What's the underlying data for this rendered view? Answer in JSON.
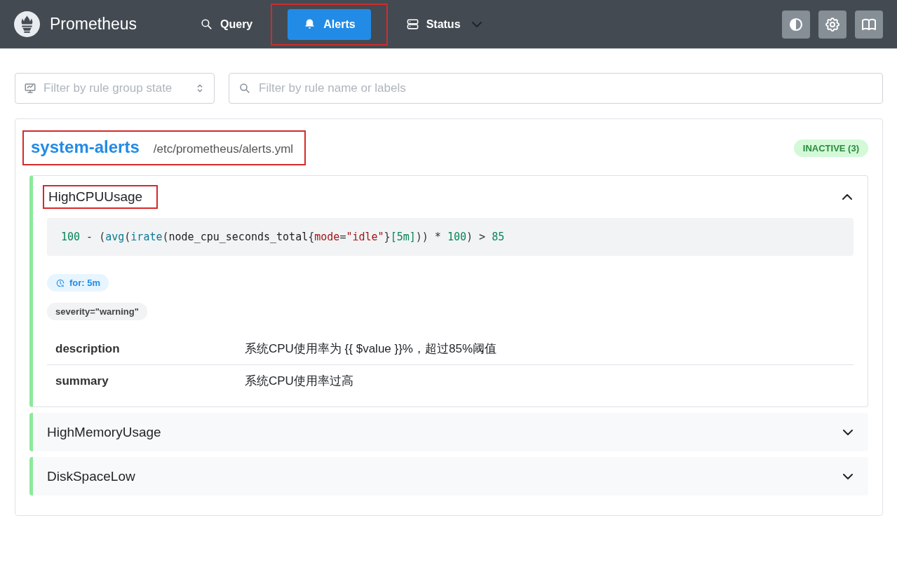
{
  "header": {
    "brand": "Prometheus",
    "nav": [
      {
        "label": "Query",
        "selected": false,
        "highlighted": false,
        "dropdown": false
      },
      {
        "label": "Alerts",
        "selected": true,
        "highlighted": true,
        "dropdown": false
      },
      {
        "label": "Status",
        "selected": false,
        "highlighted": false,
        "dropdown": true
      }
    ]
  },
  "filters": {
    "state_select": {
      "placeholder": "Filter by rule group state"
    },
    "search": {
      "placeholder": "Filter by rule name or labels"
    }
  },
  "groups": [
    {
      "name": "system-alerts",
      "file": "/etc/prometheus/alerts.yml",
      "highlighted": true,
      "badge": "INACTIVE (3)",
      "rules": [
        {
          "name": "HighCPUUsage",
          "expanded": true,
          "highlighted": true,
          "expression": [
            {
              "kind": "number",
              "text": "100"
            },
            {
              "kind": "op",
              "text": " - "
            },
            {
              "kind": "paren",
              "text": "("
            },
            {
              "kind": "func",
              "text": "avg"
            },
            {
              "kind": "paren",
              "text": "("
            },
            {
              "kind": "func",
              "text": "irate"
            },
            {
              "kind": "paren",
              "text": "("
            },
            {
              "kind": "metric",
              "text": "node_cpu_seconds_total"
            },
            {
              "kind": "paren",
              "text": "{"
            },
            {
              "kind": "label",
              "text": "mode"
            },
            {
              "kind": "op",
              "text": "="
            },
            {
              "kind": "string",
              "text": "\"idle\""
            },
            {
              "kind": "paren",
              "text": "}"
            },
            {
              "kind": "duration",
              "text": "[5m]"
            },
            {
              "kind": "paren",
              "text": "))"
            },
            {
              "kind": "op",
              "text": " * "
            },
            {
              "kind": "number",
              "text": "100"
            },
            {
              "kind": "paren",
              "text": ")"
            },
            {
              "kind": "op",
              "text": " > "
            },
            {
              "kind": "number",
              "text": "85"
            }
          ],
          "for": "for: 5m",
          "labels": [
            "severity=\"warning\""
          ],
          "annotations": [
            {
              "key": "description",
              "value": "系统CPU使用率为 {{ $value }}%，超过85%阈值"
            },
            {
              "key": "summary",
              "value": "系统CPU使用率过高"
            }
          ]
        },
        {
          "name": "HighMemoryUsage",
          "expanded": false,
          "highlighted": false
        },
        {
          "name": "DiskSpaceLow",
          "expanded": false,
          "highlighted": false
        }
      ]
    }
  ]
}
